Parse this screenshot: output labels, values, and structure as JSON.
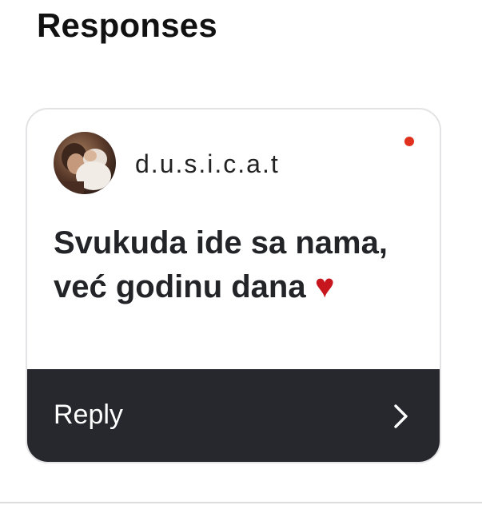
{
  "section": {
    "title": "Responses"
  },
  "response": {
    "username": "d.u.s.i.c.a.t",
    "message_text": "Svukuda ide sa nama, već godinu dana",
    "message_emoji": "♥",
    "unread": true,
    "avatar_icon": "user-photo-avatar"
  },
  "reply": {
    "label": "Reply",
    "icon": "chevron-right-icon"
  },
  "colors": {
    "unread_dot": "#e0301e",
    "reply_bar": "#26282d",
    "heart": "#c8161e"
  }
}
